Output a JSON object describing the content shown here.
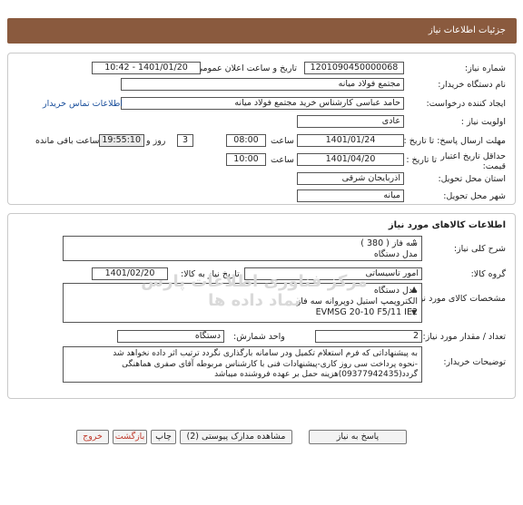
{
  "header": {
    "title": "جزئیات اطلاعات نیاز"
  },
  "details": {
    "need_number_label": "شماره نیاز:",
    "need_number": "1201090450000068",
    "announce_label": "تاریخ و ساعت اعلان عمومی:",
    "announce_value": "1401/01/20 - 10:42",
    "buyer_org_label": "نام دستگاه خریدار:",
    "buyer_org": "مجتمع فولاد میانه",
    "creator_label": "ایجاد کننده درخواست:",
    "creator": "حامد عباسی کارشناس خرید مجتمع فولاد میانه",
    "contact_link": "اطلاعات تماس خریدار",
    "priority_label": "اولویت نیاز :",
    "priority": "عادی",
    "deadline_label": "مهلت ارسال پاسخ: تا تاریخ :",
    "deadline_date": "1401/01/24",
    "time_label": "ساعت",
    "deadline_time": "08:00",
    "days": "3",
    "days_label": "روز و",
    "remaining_time": "19:55:10",
    "remaining_label": "ساعت باقی مانده",
    "validity_label": "حداقل تاریخ اعتبار قیمت:",
    "validity_to_label": "تا تاریخ :",
    "validity_date": "1401/04/20",
    "validity_time": "10:00",
    "province_label": "استان محل تحویل:",
    "province": "آذربایجان شرقی",
    "city_label": "شهر محل تحویل:",
    "city": "میانه"
  },
  "goods": {
    "section_title": "اطلاعات کالاهای مورد نیاز",
    "summary_label": "شرح کلی نیاز:",
    "summary_lines": [
      "سه فاز ( 380 )",
      "مدل دستگاه"
    ],
    "group_label": "گروه کالا:",
    "group": "امور تاسیساتی",
    "need_date_label": "تاریخ نیاز به کالا:",
    "need_date": "1401/02/20",
    "spec_label": "مشخصات کالای مورد نیاز:",
    "spec_lines": [
      "مدل دستگاه",
      "الکتروپمپ استیل دوپروانه سه فاز",
      "EVMSG 20-10 F5/11 IE2"
    ],
    "qty_label": "تعداد / مقدار مورد نیاز:",
    "qty": "2",
    "unit_label": "واحد شمارش:",
    "unit": "دستگاه",
    "notes_label": "توضیحات خریدار:",
    "notes_lines": [
      "به پیشنهاداتی که فرم استعلام تکمیل ودر سامانه بارگذاری نگردد ترتیب اثر داده نخواهد شد",
      "-نحوه پرداخت سی روز کاری-پیشنهادات فنی با کارشناس مربوطه آقای صفری هماهنگی",
      "گردد(09377942435)هزینه حمل بر عهده فروشنده میباشد"
    ],
    "watermark": "مرکز فناوری اطلاعات پارس نماد داده ها"
  },
  "buttons": {
    "reply": "پاسخ به نیاز",
    "attachments": "مشاهده مدارک پیوستی (2)",
    "print": "چاپ",
    "back": "بازگشت",
    "exit": "خروج"
  }
}
